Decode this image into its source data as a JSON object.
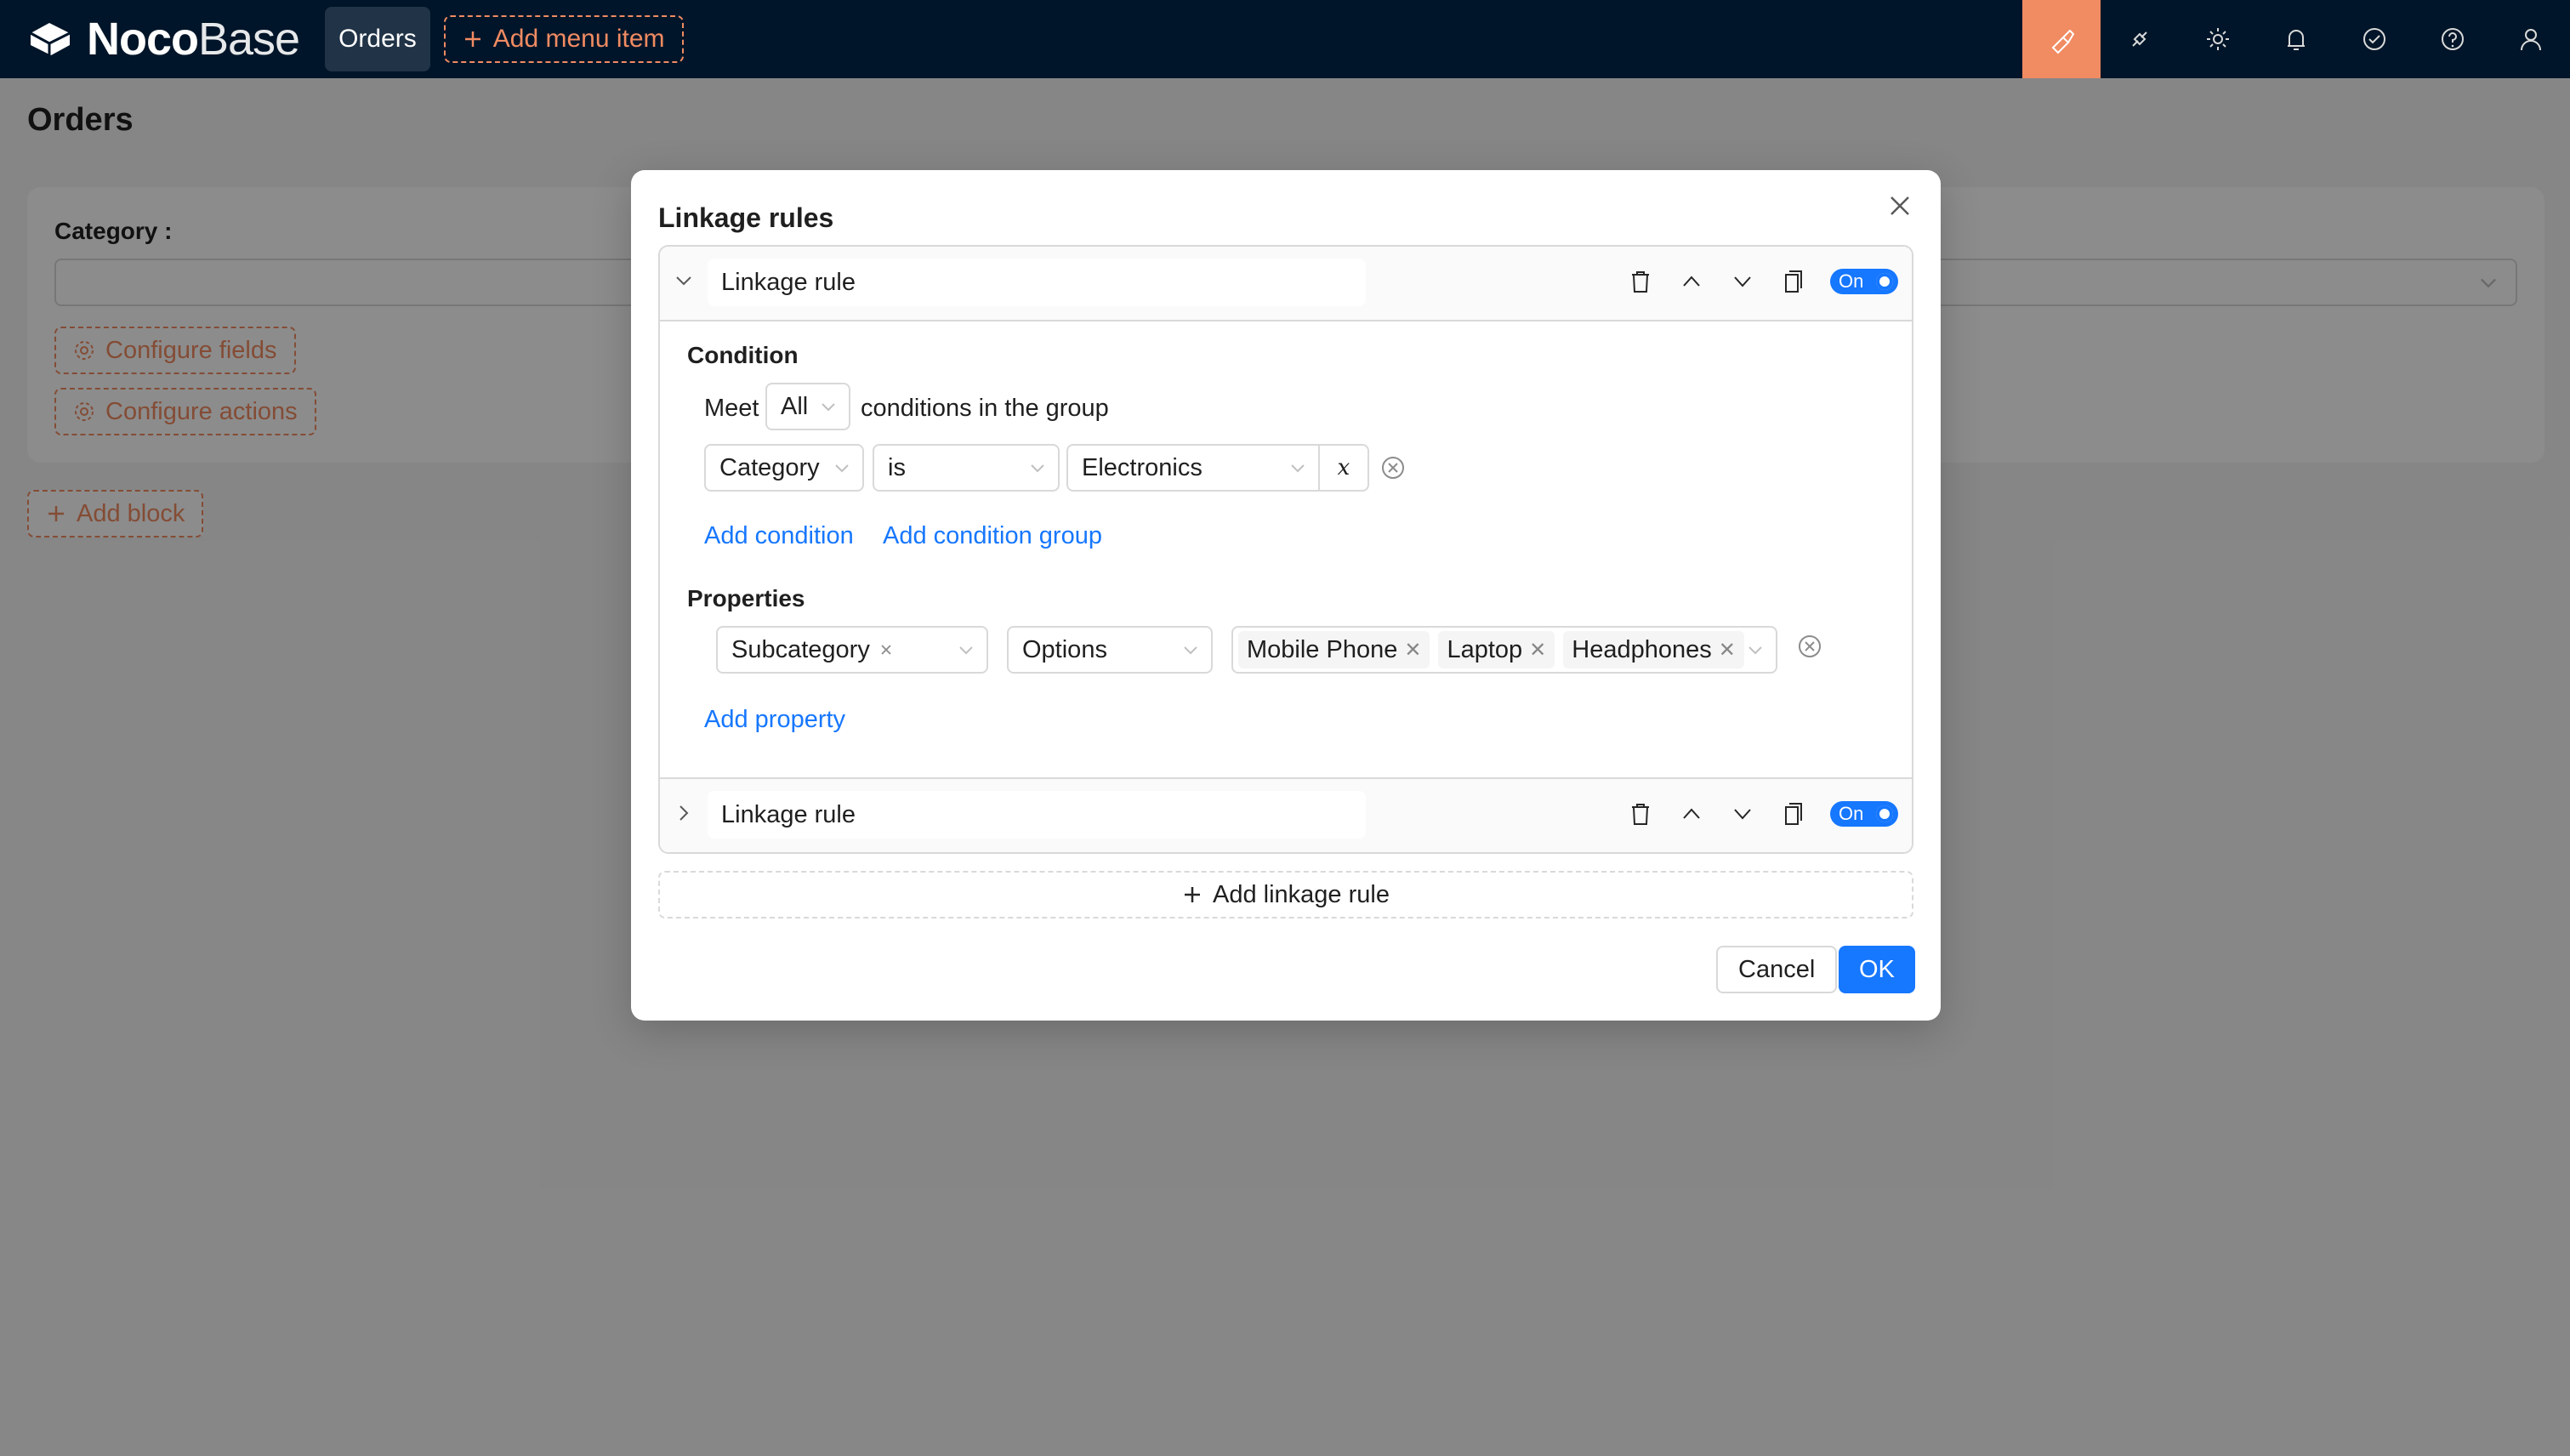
{
  "app": {
    "logo_bold": "Noco",
    "logo_light": "Base",
    "menu_item": "Orders",
    "add_menu_item": "Add menu item"
  },
  "topbar_icons": [
    "brush-icon",
    "plugin-icon",
    "gear-icon",
    "bell-icon",
    "check-circle-icon",
    "help-icon",
    "user-icon"
  ],
  "page": {
    "title": "Orders",
    "category_label": "Category",
    "category_value": "",
    "configure_fields": "Configure fields",
    "configure_actions": "Configure actions",
    "add_block": "Add block"
  },
  "modal": {
    "title": "Linkage rules",
    "rules": [
      {
        "title": "Linkage rule",
        "expanded": true,
        "toggle": "On",
        "condition": {
          "label": "Condition",
          "meet_prefix": "Meet",
          "meet_value": "All",
          "meet_suffix": "conditions in the group",
          "field": "Category",
          "operator": "is",
          "value": "Electronics",
          "var_button": "x",
          "add_condition": "Add condition",
          "add_condition_group": "Add condition group"
        },
        "properties": {
          "label": "Properties",
          "field": "Subcategory",
          "action": "Options",
          "options": [
            "Mobile Phone",
            "Laptop",
            "Headphones"
          ],
          "add_property": "Add property"
        }
      },
      {
        "title": "Linkage rule",
        "expanded": false,
        "toggle": "On"
      }
    ],
    "add_rule": "Add linkage rule",
    "cancel": "Cancel",
    "ok": "OK"
  },
  "colors": {
    "topbar": "#001529",
    "accent": "#f18b62",
    "primary": "#1677ff"
  }
}
